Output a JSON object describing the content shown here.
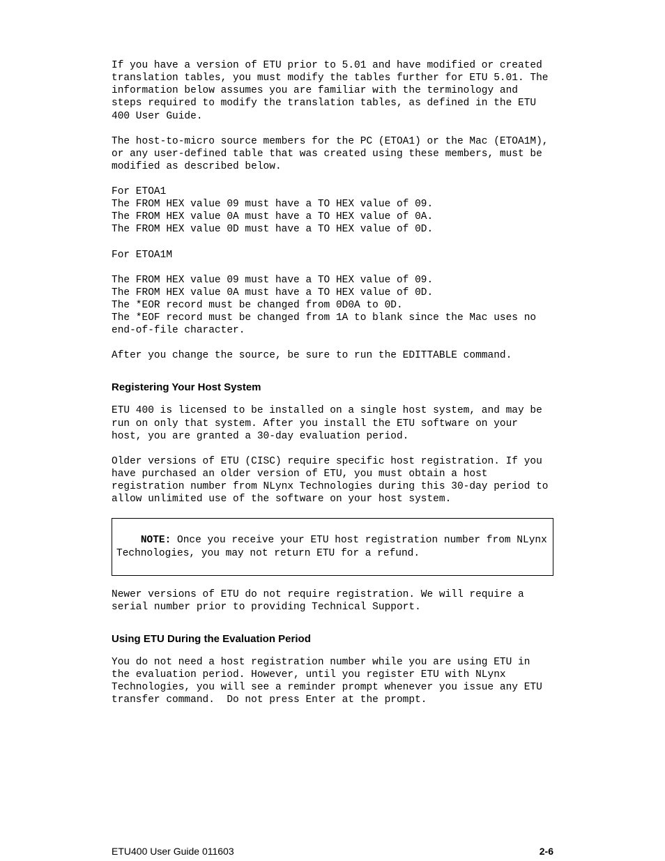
{
  "paragraphs": {
    "p1": "If you have a version of ETU prior to 5.01 and have modified or created translation tables, you must modify the tables further for ETU 5.01. The information below assumes you are familiar with the terminology and steps required to modify the translation tables, as defined in the ETU 400 User Guide.",
    "p2": "The host-to-micro source members for the PC (ETOA1) or the Mac (ETOA1M), or any user-defined table that was created using these members, must be modified as described below.",
    "p3": "For ETOA1\nThe FROM HEX value 09 must have a TO HEX value of 09.\nThe FROM HEX value 0A must have a TO HEX value of 0A.\nThe FROM HEX value 0D must have a TO HEX value of 0D.",
    "p4": "For ETOA1M",
    "p5": "The FROM HEX value 09 must have a TO HEX value of 09.\nThe FROM HEX value 0A must have a TO HEX value of 0D.\nThe *EOR record must be changed from 0D0A to 0D.\nThe *EOF record must be changed from 1A to blank since the Mac uses no end-of-file character.",
    "p6": "After you change the source, be sure to run the EDITTABLE command.",
    "h1": "Registering Your Host System",
    "p7": "ETU 400 is licensed to be installed on a single host system, and may be run on only that system. After you install the ETU software on your host, you are granted a 30-day evaluation period.",
    "p8": "Older versions of ETU (CISC) require specific host registration. If you have purchased an older version of ETU, you must obtain a host registration number from NLynx Technologies during this 30-day period to allow unlimited use of the software on your host system.",
    "note_label": "NOTE:",
    "note_body": " Once you receive your ETU host registration number from NLynx Technologies, you may not return ETU for a refund.",
    "p9": "Newer versions of ETU do not require registration. We will require a serial number prior to providing Technical Support.",
    "h2": "Using ETU During the Evaluation Period",
    "p10": "You do not need a host registration number while you are using ETU in the evaluation period. However, until you register ETU with NLynx Technologies, you will see a reminder prompt whenever you issue any ETU transfer command.  Do not press Enter at the prompt."
  },
  "footer": {
    "title": "ETU400 User Guide 011603",
    "page": "2-6"
  }
}
